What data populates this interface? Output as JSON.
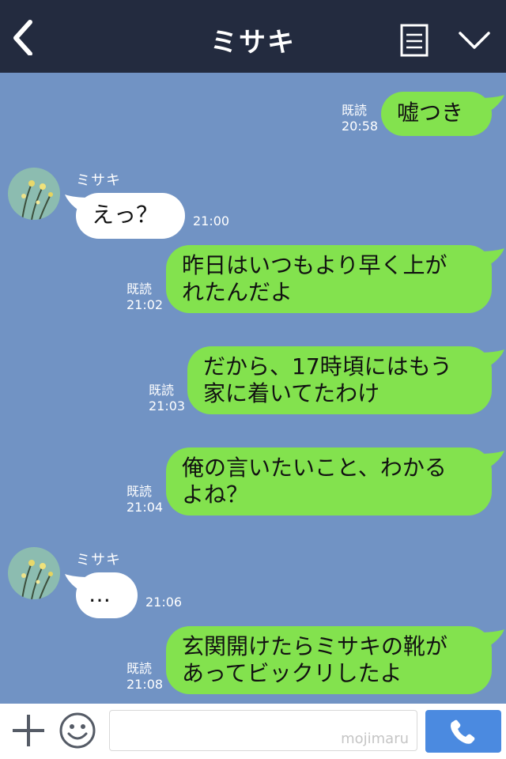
{
  "header": {
    "title": "ミサキ"
  },
  "messages": [
    {
      "side": "right",
      "text": "嘘つき",
      "status": "既読",
      "time": "20:58"
    },
    {
      "side": "left",
      "sender": "ミサキ",
      "text": "えっ？",
      "time": "21:00"
    },
    {
      "side": "right",
      "text": "昨日はいつもより早く上が\nれたんだよ",
      "status": "既読",
      "time": "21:02"
    },
    {
      "side": "right",
      "text": "だから、17時頃にはもう\n家に着いてたわけ",
      "status": "既読",
      "time": "21:03"
    },
    {
      "side": "right",
      "text": "俺の言いたいこと、わかる\nよね？",
      "status": "既読",
      "time": "21:04"
    },
    {
      "side": "left",
      "sender": "ミサキ",
      "text": "…",
      "time": "21:06"
    },
    {
      "side": "right",
      "text": "玄関開けたらミサキの靴が\nあってビックリしたよ",
      "status": "既読",
      "time": "21:08"
    }
  ],
  "input": {
    "placeholder": "",
    "watermark": "mojimaru"
  },
  "colors": {
    "header_bg": "#232b3f",
    "chat_bg": "#7193c4",
    "my_bubble": "#83e24e",
    "their_bubble": "#ffffff",
    "call_button": "#4b8ae0"
  },
  "icons": [
    "back-arrow-icon",
    "menu-list-icon",
    "chevron-down-icon",
    "plus-icon",
    "smiley-icon",
    "phone-icon"
  ]
}
